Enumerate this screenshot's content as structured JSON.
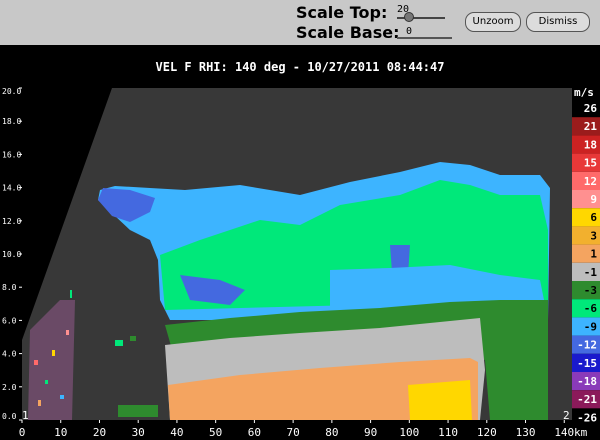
{
  "toolbar": {
    "scale_top_label": "Scale Top:",
    "scale_top_value": "20",
    "scale_base_label": "Scale Base:",
    "scale_base_value": "0",
    "unzoom_label": "Unzoom",
    "dismiss_label": "Dismiss"
  },
  "chart_data": {
    "type": "heatmap",
    "title": "VEL F  RHI: 140 deg  -  10/27/2011 08:44:47",
    "x_unit": "km",
    "x_ticks": [
      "0",
      "10",
      "20",
      "30",
      "40",
      "50",
      "60",
      "70",
      "80",
      "90",
      "100",
      "110",
      "120",
      "130",
      "140"
    ],
    "xlim": [
      0,
      142
    ],
    "y_ticks": [
      "0.0",
      "2.0",
      "4.0",
      "6.0",
      "8.0",
      "10.0",
      "12.0",
      "14.0",
      "16.0",
      "18.0",
      "20.0"
    ],
    "ylim": [
      0,
      20
    ],
    "legend_unit": "m/s",
    "legend": [
      {
        "label": "26",
        "color": "#000000",
        "text": "#ffffff"
      },
      {
        "label": "21",
        "color": "#9b1c1c",
        "text": "#ffffff"
      },
      {
        "label": "18",
        "color": "#cc2222",
        "text": "#ffffff"
      },
      {
        "label": "15",
        "color": "#e83838",
        "text": "#ffffff"
      },
      {
        "label": "12",
        "color": "#ff6a6a",
        "text": "#ffffff"
      },
      {
        "label": "9",
        "color": "#ff9090",
        "text": "#ffffff"
      },
      {
        "label": "6",
        "color": "#ffd700",
        "text": "#000000"
      },
      {
        "label": "3",
        "color": "#f2b02e",
        "text": "#000000"
      },
      {
        "label": "1",
        "color": "#f4a460",
        "text": "#000000"
      },
      {
        "label": "-1",
        "color": "#bdbdbd",
        "text": "#000000"
      },
      {
        "label": "-3",
        "color": "#2e8b2e",
        "text": "#000000"
      },
      {
        "label": "-6",
        "color": "#00e87a",
        "text": "#000000"
      },
      {
        "label": "-9",
        "color": "#3db4ff",
        "text": "#000000"
      },
      {
        "label": "-12",
        "color": "#4469e0",
        "text": "#ffffff"
      },
      {
        "label": "-15",
        "color": "#1a1acc",
        "text": "#ffffff"
      },
      {
        "label": "-18",
        "color": "#8a3ab9",
        "text": "#ffffff"
      },
      {
        "label": "-21",
        "color": "#8b1a5a",
        "text": "#ffffff"
      },
      {
        "label": "-26",
        "color": "#000000",
        "text": "#ffffff"
      }
    ],
    "corner_labels": {
      "left": "1",
      "right": "2"
    }
  }
}
